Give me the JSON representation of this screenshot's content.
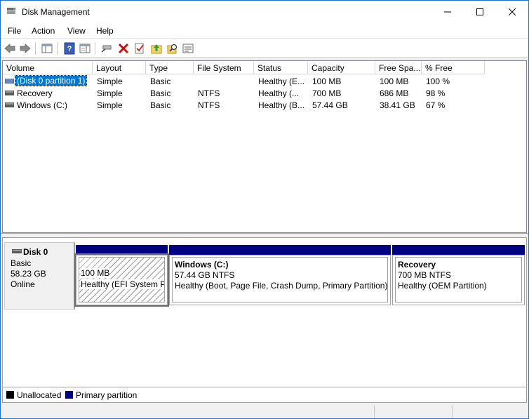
{
  "window": {
    "title": "Disk Management"
  },
  "menu": [
    "File",
    "Action",
    "View",
    "Help"
  ],
  "toolbar": {
    "icons": [
      "back-icon",
      "forward-icon",
      "console-tree-icon",
      "help-icon",
      "properties-pane-icon",
      "connect-icon",
      "delete-icon",
      "check-icon",
      "up-folder-icon",
      "search-icon",
      "settings-list-icon"
    ]
  },
  "volume_list": {
    "columns": [
      "Volume",
      "Layout",
      "Type",
      "File System",
      "Status",
      "Capacity",
      "Free Spa...",
      "% Free"
    ],
    "rows": [
      [
        "(Disk 0 partition 1)",
        "Simple",
        "Basic",
        "",
        "Healthy (E...",
        "100 MB",
        "100 MB",
        "100 %"
      ],
      [
        "Recovery",
        "Simple",
        "Basic",
        "NTFS",
        "Healthy (...",
        "700 MB",
        "686 MB",
        "98 %"
      ],
      [
        "Windows (C:)",
        "Simple",
        "Basic",
        "NTFS",
        "Healthy (B...",
        "57.44 GB",
        "38.41 GB",
        "67 %"
      ]
    ]
  },
  "disk": {
    "name": "Disk 0",
    "type": "Basic",
    "size": "58.23 GB",
    "state": "Online",
    "partitions": [
      {
        "title": "",
        "line1": "100 MB",
        "line2": "Healthy (EFI System Partition)"
      },
      {
        "title": "Windows  (C:)",
        "line1": "57.44 GB NTFS",
        "line2": "Healthy (Boot, Page File, Crash Dump, Primary Partition)"
      },
      {
        "title": "Recovery",
        "line1": "700 MB NTFS",
        "line2": "Healthy (OEM Partition)"
      }
    ]
  },
  "legend": [
    {
      "label": "Unallocated",
      "color": "#000000"
    },
    {
      "label": "Primary partition",
      "color": "#000080"
    }
  ],
  "colors": {
    "primary_partition": "#000080",
    "selection": "#0078d7",
    "window_border": "#1e6fd0"
  }
}
